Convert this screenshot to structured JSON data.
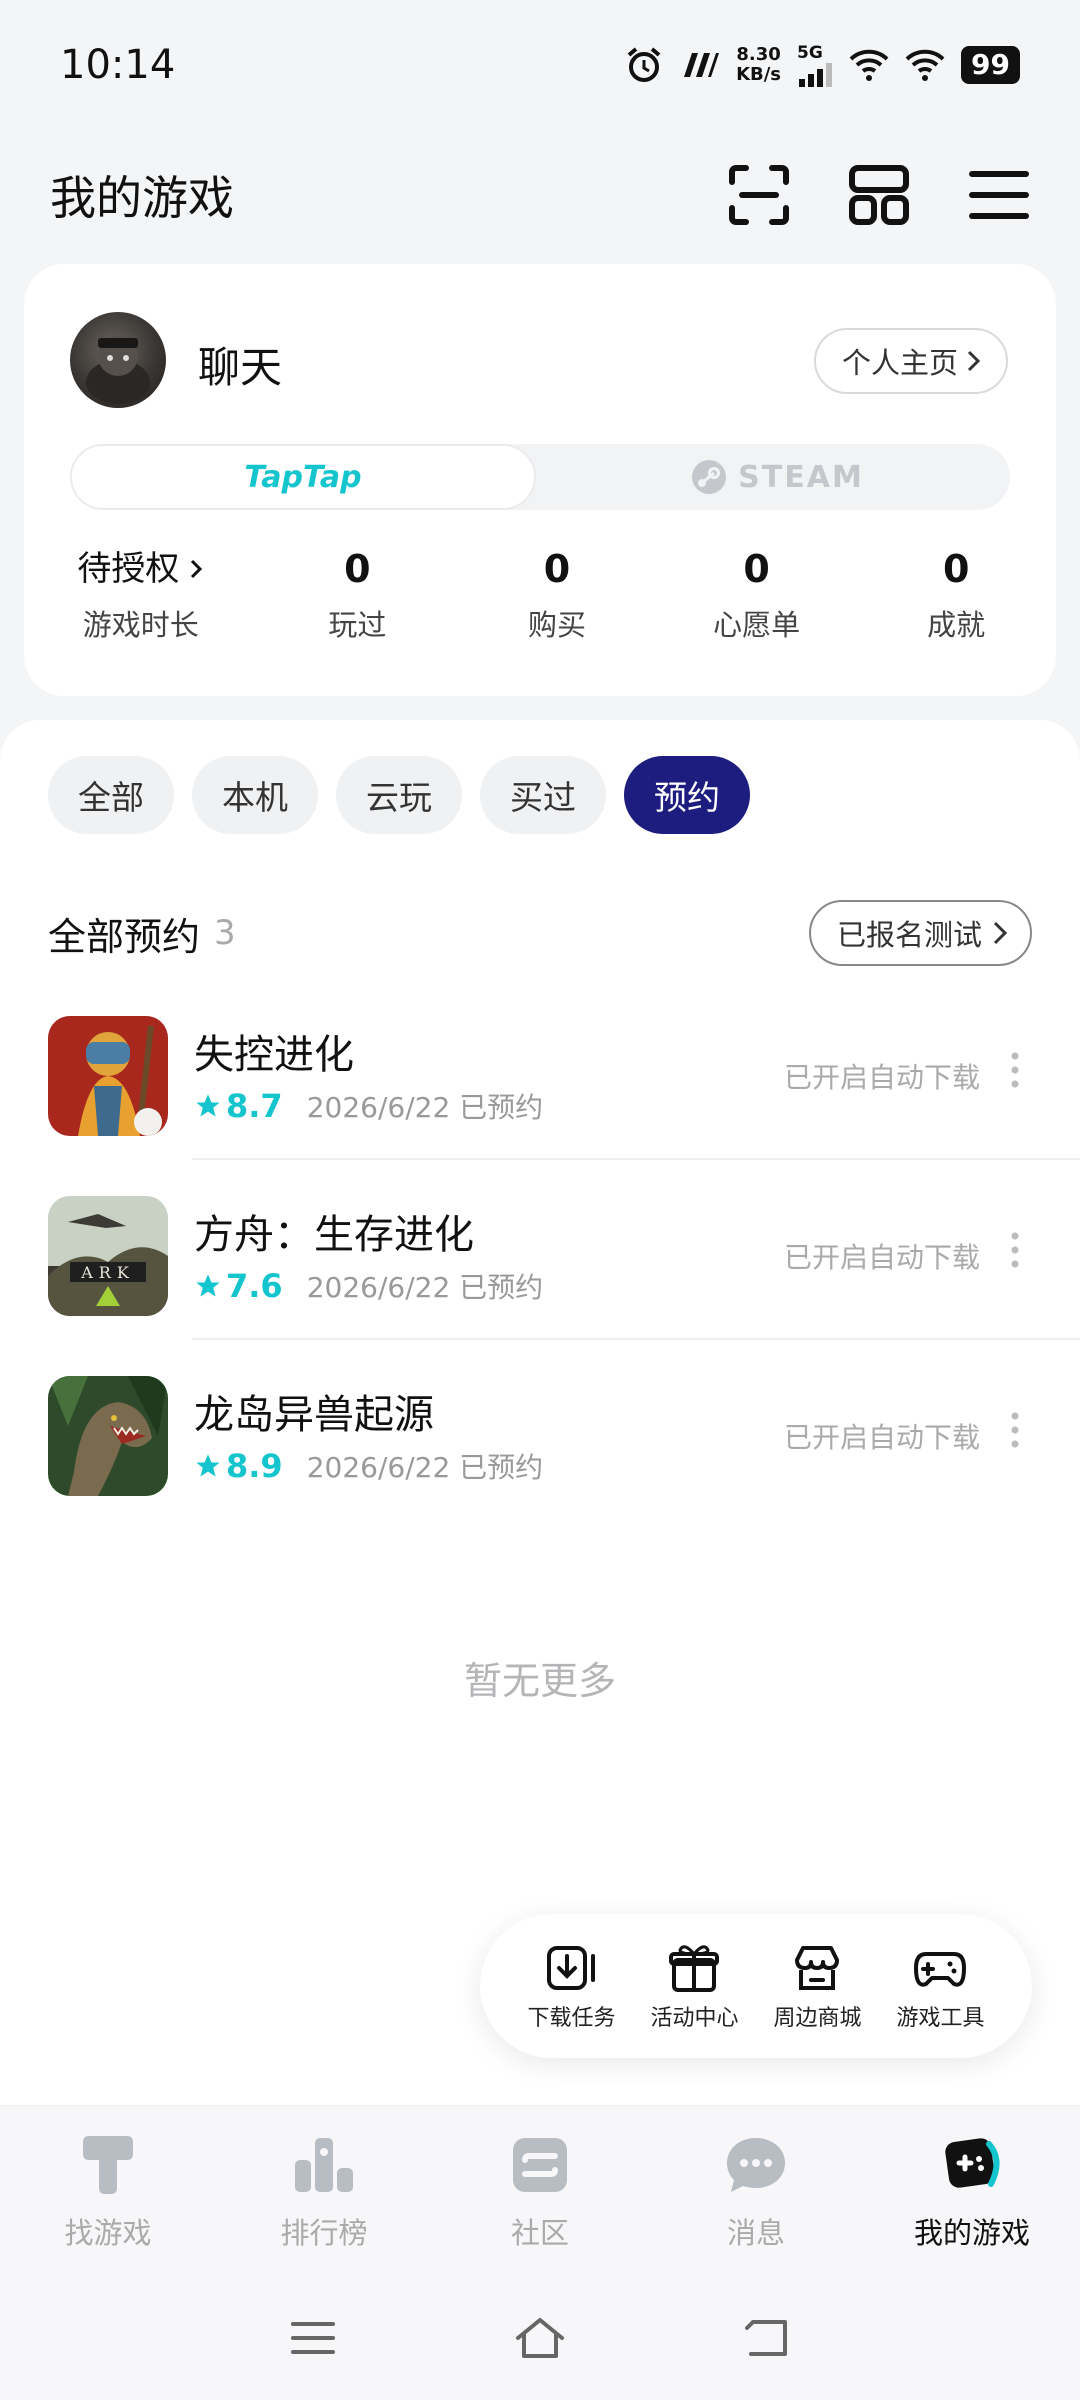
{
  "status": {
    "time": "10:14",
    "net_speed_value": "8.30",
    "net_speed_unit": "KB/s",
    "network": "5G",
    "battery": "99"
  },
  "header": {
    "title": "我的游戏",
    "actions": [
      "scan-icon",
      "grid-icon",
      "menu-icon"
    ]
  },
  "profile": {
    "username": "聊天",
    "home_link": "个人主页",
    "platforms": [
      "TapTap",
      "STEAM"
    ],
    "active_platform": "TapTap",
    "stats": [
      {
        "value": "待授权",
        "label": "游戏时长"
      },
      {
        "value": "0",
        "label": "玩过"
      },
      {
        "value": "0",
        "label": "购买"
      },
      {
        "value": "0",
        "label": "心愿单"
      },
      {
        "value": "0",
        "label": "成就"
      }
    ]
  },
  "filters": {
    "chips": [
      "全部",
      "本机",
      "云玩",
      "买过",
      "预约"
    ],
    "active": "预约"
  },
  "section": {
    "title": "全部预约",
    "count": "3",
    "tested_link": "已报名测试"
  },
  "games": [
    {
      "name": "失控进化",
      "rating": "8.7",
      "reserved": "2026/6/22 已预约",
      "status": "已开启自动下载"
    },
    {
      "name": "方舟：生存进化",
      "rating": "7.6",
      "reserved": "2026/6/22 已预约",
      "status": "已开启自动下载"
    },
    {
      "name": "龙岛异兽起源",
      "rating": "8.9",
      "reserved": "2026/6/22 已预约",
      "status": "已开启自动下载"
    }
  ],
  "empty_hint": "暂无更多",
  "quick_tools": [
    {
      "label": "下载任务",
      "icon": "download-task-icon"
    },
    {
      "label": "活动中心",
      "icon": "gift-icon"
    },
    {
      "label": "周边商城",
      "icon": "shop-icon"
    },
    {
      "label": "游戏工具",
      "icon": "gamepad-icon"
    }
  ],
  "tabs": [
    {
      "label": "找游戏",
      "icon": "find-game-icon"
    },
    {
      "label": "排行榜",
      "icon": "ranking-icon"
    },
    {
      "label": "社区",
      "icon": "community-icon"
    },
    {
      "label": "消息",
      "icon": "message-icon"
    },
    {
      "label": "我的游戏",
      "icon": "my-games-icon"
    }
  ],
  "active_tab": "我的游戏",
  "colors": {
    "accent": "#15c5ce",
    "active_chip": "#1d1d80",
    "background": "#f4f5f7"
  }
}
